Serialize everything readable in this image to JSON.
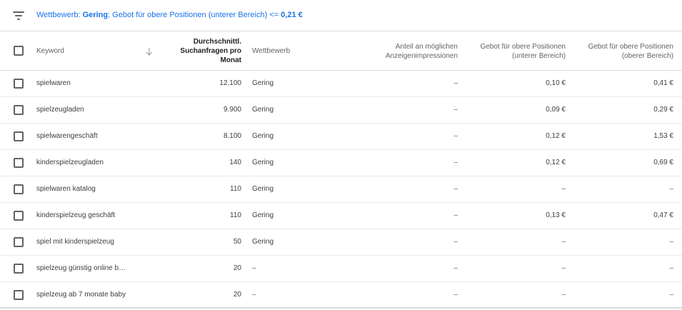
{
  "filter": {
    "label_prefix": "Wettbewerb: ",
    "label_value1": "Gering",
    "label_mid": "; Gebot für obere Positionen (unterer Bereich) <= ",
    "label_value2": "0,21 €",
    "icon": "filter-icon"
  },
  "columns": {
    "keyword": "Keyword",
    "searches_line1": "Durchschnittl.",
    "searches_line2": "Suchanfragen pro",
    "searches_line3": "Monat",
    "competition": "Wettbewerb",
    "impression_line1": "Anteil an möglichen",
    "impression_line2": "Anzeigenimpressionen",
    "bid_low_line1": "Gebot für obere Positionen",
    "bid_low_line2": "(unterer Bereich)",
    "bid_high_line1": "Gebot für obere Positionen",
    "bid_high_line2": "(oberer Bereich)",
    "sort_icon": "arrow-down-icon"
  },
  "rows": [
    {
      "keyword": "spielwaren",
      "searches": "12.100",
      "competition": "Gering",
      "impression": "–",
      "bid_low": "0,10 €",
      "bid_high": "0,41 €"
    },
    {
      "keyword": "spielzeugladen",
      "searches": "9.900",
      "competition": "Gering",
      "impression": "–",
      "bid_low": "0,09 €",
      "bid_high": "0,29 €"
    },
    {
      "keyword": "spielwarengeschäft",
      "searches": "8.100",
      "competition": "Gering",
      "impression": "–",
      "bid_low": "0,12 €",
      "bid_high": "1,53 €"
    },
    {
      "keyword": "kinderspielzeugladen",
      "searches": "140",
      "competition": "Gering",
      "impression": "–",
      "bid_low": "0,12 €",
      "bid_high": "0,69 €"
    },
    {
      "keyword": "spielwaren katalog",
      "searches": "110",
      "competition": "Gering",
      "impression": "–",
      "bid_low": "–",
      "bid_high": "–"
    },
    {
      "keyword": "kinderspielzeug geschäft",
      "searches": "110",
      "competition": "Gering",
      "impression": "–",
      "bid_low": "0,13 €",
      "bid_high": "0,47 €"
    },
    {
      "keyword": "spiel mit kinderspielzeug",
      "searches": "50",
      "competition": "Gering",
      "impression": "–",
      "bid_low": "–",
      "bid_high": "–"
    },
    {
      "keyword": "spielzeug günstig online b…",
      "searches": "20",
      "competition": "–",
      "impression": "–",
      "bid_low": "–",
      "bid_high": "–"
    },
    {
      "keyword": "spielzeug ab 7 monate baby",
      "searches": "20",
      "competition": "–",
      "impression": "–",
      "bid_low": "–",
      "bid_high": "–"
    }
  ]
}
